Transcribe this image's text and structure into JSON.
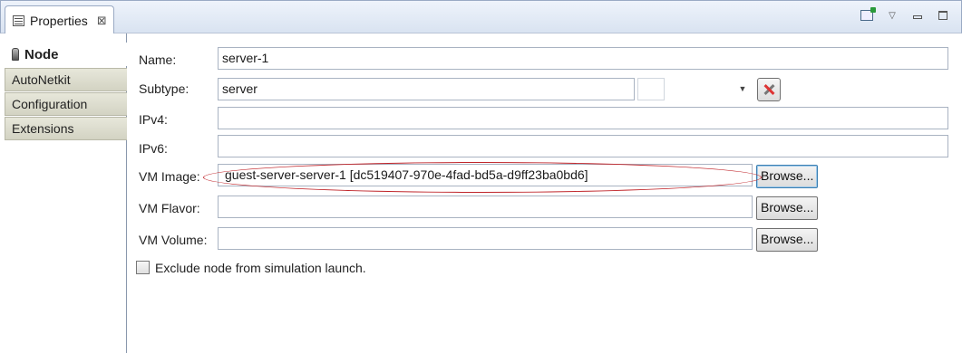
{
  "view": {
    "tab_title": "Properties",
    "close_glyph": "⊠",
    "menu_glyph": "▽"
  },
  "side_tabs": [
    {
      "label": "Node",
      "active": true
    },
    {
      "label": "AutoNetkit",
      "active": false
    },
    {
      "label": "Configuration",
      "active": false
    },
    {
      "label": "Extensions",
      "active": false
    }
  ],
  "form": {
    "name": {
      "label": "Name:",
      "value": "server-1"
    },
    "subtype": {
      "label": "Subtype:",
      "value": "server",
      "arrow": "▼"
    },
    "ipv4": {
      "label": "IPv4:",
      "value": ""
    },
    "ipv6": {
      "label": "IPv6:",
      "value": ""
    },
    "vm_image": {
      "label": "VM Image:",
      "value": "guest-server-server-1 [dc519407-970e-4fad-bd5a-d9ff23ba0bd6]",
      "button": "Browse..."
    },
    "vm_flavor": {
      "label": "VM Flavor:",
      "value": "",
      "button": "Browse..."
    },
    "vm_volume": {
      "label": "VM Volume:",
      "value": "",
      "button": "Browse..."
    },
    "exclude": {
      "label": "Exclude node from simulation launch.",
      "checked": false
    }
  },
  "colors": {
    "highlight": "#c0262b",
    "tab_bar": "#d9e3f1"
  }
}
